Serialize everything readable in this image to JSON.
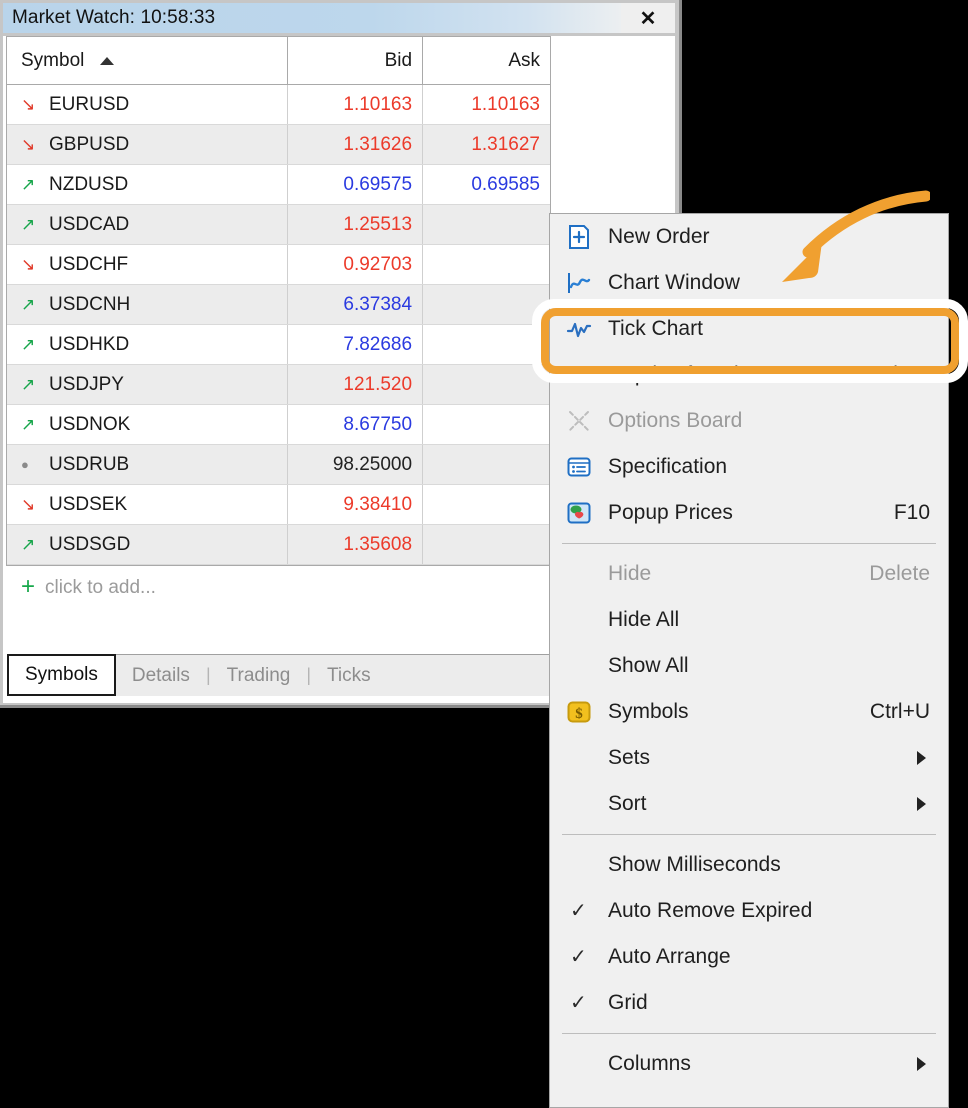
{
  "window": {
    "title": "Market Watch: 10:58:33",
    "close_label": "✕"
  },
  "table": {
    "headers": {
      "symbol": "Symbol",
      "bid": "Bid",
      "ask": "Ask"
    },
    "sort_column": "Symbol",
    "sort_direction": "ascending",
    "rows": [
      {
        "dir": "down",
        "symbol": "EURUSD",
        "bid": "1.10163",
        "bid_color": "up",
        "ask": "1.10163",
        "ask_color": "up"
      },
      {
        "dir": "down",
        "symbol": "GBPUSD",
        "bid": "1.31626",
        "bid_color": "up",
        "ask": "1.31627",
        "ask_color": "up"
      },
      {
        "dir": "up",
        "symbol": "NZDUSD",
        "bid": "0.69575",
        "bid_color": "down",
        "ask": "0.69585",
        "ask_color": "down"
      },
      {
        "dir": "up",
        "symbol": "USDCAD",
        "bid": "1.25513",
        "bid_color": "up",
        "ask": "",
        "ask_color": "up"
      },
      {
        "dir": "down",
        "symbol": "USDCHF",
        "bid": "0.92703",
        "bid_color": "up",
        "ask": "",
        "ask_color": "up"
      },
      {
        "dir": "up",
        "symbol": "USDCNH",
        "bid": "6.37384",
        "bid_color": "down",
        "ask": "",
        "ask_color": "down"
      },
      {
        "dir": "up",
        "symbol": "USDHKD",
        "bid": "7.82686",
        "bid_color": "down",
        "ask": "",
        "ask_color": "down"
      },
      {
        "dir": "up",
        "symbol": "USDJPY",
        "bid": "121.520",
        "bid_color": "up",
        "ask": "",
        "ask_color": "up"
      },
      {
        "dir": "up",
        "symbol": "USDNOK",
        "bid": "8.67750",
        "bid_color": "down",
        "ask": "",
        "ask_color": "down"
      },
      {
        "dir": "flat",
        "symbol": "USDRUB",
        "bid": "98.25000",
        "bid_color": "flat",
        "ask": "",
        "ask_color": "flat"
      },
      {
        "dir": "down",
        "symbol": "USDSEK",
        "bid": "9.38410",
        "bid_color": "up",
        "ask": "",
        "ask_color": "up"
      },
      {
        "dir": "up",
        "symbol": "USDSGD",
        "bid": "1.35608",
        "bid_color": "up",
        "ask": "",
        "ask_color": "up"
      }
    ],
    "add_row": {
      "plus": "+",
      "label": "click to add..."
    }
  },
  "tabs": [
    {
      "label": "Symbols",
      "active": true
    },
    {
      "label": "Details",
      "active": false
    },
    {
      "label": "Trading",
      "active": false
    },
    {
      "label": "Ticks",
      "active": false
    }
  ],
  "context_menu": {
    "items": [
      {
        "label": "New Order",
        "icon": "new-order-icon",
        "accel": "",
        "disabled": false,
        "checked": false,
        "submenu": false
      },
      {
        "label": "Chart Window",
        "icon": "chart-window-icon",
        "accel": "",
        "disabled": false,
        "checked": false,
        "submenu": false
      },
      {
        "label": "Tick Chart",
        "icon": "tick-chart-icon",
        "accel": "",
        "disabled": false,
        "checked": false,
        "submenu": false,
        "highlighted": true
      },
      {
        "label": "Depth Of Market",
        "icon": "depth-of-market-icon",
        "accel": "Alt+B",
        "disabled": false,
        "checked": false,
        "submenu": false
      },
      {
        "label": "Options Board",
        "icon": "options-board-icon",
        "accel": "",
        "disabled": true,
        "checked": false,
        "submenu": false
      },
      {
        "label": "Specification",
        "icon": "specification-icon",
        "accel": "",
        "disabled": false,
        "checked": false,
        "submenu": false
      },
      {
        "label": "Popup Prices",
        "icon": "popup-prices-icon",
        "accel": "F10",
        "disabled": false,
        "checked": false,
        "submenu": false
      },
      {
        "separator": true
      },
      {
        "label": "Hide",
        "icon": "",
        "accel": "Delete",
        "disabled": true,
        "checked": false,
        "submenu": false
      },
      {
        "label": "Hide All",
        "icon": "",
        "accel": "",
        "disabled": false,
        "checked": false,
        "submenu": false
      },
      {
        "label": "Show All",
        "icon": "",
        "accel": "",
        "disabled": false,
        "checked": false,
        "submenu": false
      },
      {
        "label": "Symbols",
        "icon": "symbols-dollar-icon",
        "accel": "Ctrl+U",
        "disabled": false,
        "checked": false,
        "submenu": false
      },
      {
        "label": "Sets",
        "icon": "",
        "accel": "",
        "disabled": false,
        "checked": false,
        "submenu": true
      },
      {
        "label": "Sort",
        "icon": "",
        "accel": "",
        "disabled": false,
        "checked": false,
        "submenu": true
      },
      {
        "separator": true
      },
      {
        "label": "Show Milliseconds",
        "icon": "",
        "accel": "",
        "disabled": false,
        "checked": false,
        "submenu": false
      },
      {
        "label": "Auto Remove Expired",
        "icon": "",
        "accel": "",
        "disabled": false,
        "checked": true,
        "submenu": false
      },
      {
        "label": "Auto Arrange",
        "icon": "",
        "accel": "",
        "disabled": false,
        "checked": true,
        "submenu": false
      },
      {
        "label": "Grid",
        "icon": "",
        "accel": "",
        "disabled": false,
        "checked": true,
        "submenu": false
      },
      {
        "separator": true
      },
      {
        "label": "Columns",
        "icon": "",
        "accel": "",
        "disabled": false,
        "checked": false,
        "submenu": true
      }
    ]
  },
  "annotation": {
    "highlight_target": "Tick Chart",
    "highlight_color": "#f0a030",
    "arrow_color": "#f0a030"
  },
  "colors": {
    "price_up": "#ec3a2a",
    "price_down": "#2a3ae0",
    "price_flat": "#222222",
    "titlebar": "#bdd7ec",
    "menu_bg": "#f0f0f0"
  }
}
